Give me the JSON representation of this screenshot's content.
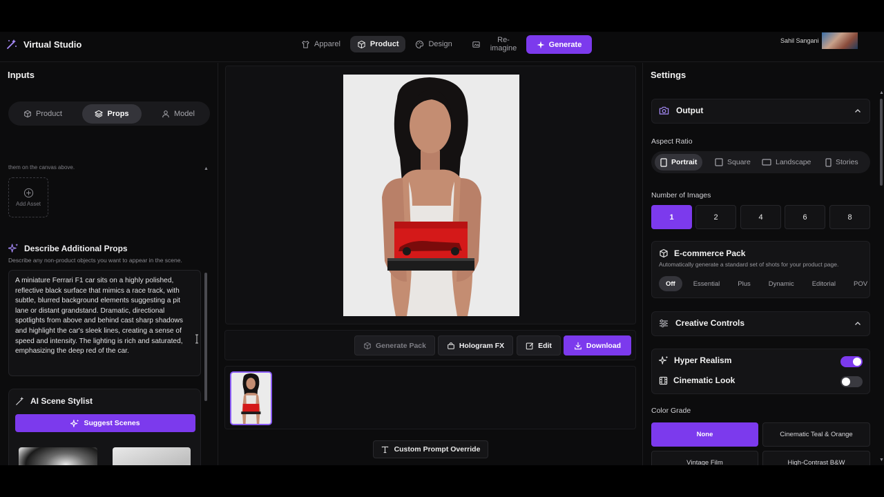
{
  "header": {
    "brand": "Virtual Studio",
    "tabs": [
      {
        "label": "Apparel",
        "icon": "shirt-icon"
      },
      {
        "label": "Product",
        "icon": "box-icon",
        "active": true
      },
      {
        "label": "Design",
        "icon": "palette-icon"
      },
      {
        "label": "Re-\nimagine",
        "icon": "reimagine-icon"
      }
    ],
    "generate_label": "Generate",
    "user_name": "Sahil Sangani"
  },
  "inputs": {
    "title": "Inputs",
    "tabs": [
      {
        "label": "Product"
      },
      {
        "label": "Props",
        "active": true
      },
      {
        "label": "Model"
      }
    ],
    "canvas_hint": "them on the canvas above.",
    "add_asset_label": "Add Asset",
    "props_title": "Describe Additional Props",
    "props_subtitle": "Describe any non-product objects you want to appear in the scene.",
    "props_text": "A miniature Ferrari F1 car sits on a highly polished, reflective black surface that mimics a race track, with subtle, blurred background elements suggesting a pit lane or distant grandstand. Dramatic, directional spotlights from above and behind cast sharp shadows and highlight the car's sleek lines, creating a sense of speed and intensity. The lighting is rich and saturated, emphasizing the deep red of the car.",
    "stylist_title": "AI Scene Stylist",
    "suggest_label": "Suggest Scenes"
  },
  "center": {
    "toolbar": {
      "generate_pack": "Generate Pack",
      "hologram": "Hologram FX",
      "edit": "Edit",
      "download": "Download"
    },
    "override_label": "Custom Prompt Override"
  },
  "settings": {
    "title": "Settings",
    "output_title": "Output",
    "aspect_label": "Aspect Ratio",
    "aspect_options": [
      {
        "label": "Portrait",
        "active": true
      },
      {
        "label": "Square"
      },
      {
        "label": "Landscape"
      },
      {
        "label": "Stories"
      }
    ],
    "num_images_label": "Number of Images",
    "num_images": [
      "1",
      "2",
      "4",
      "6",
      "8"
    ],
    "num_images_selected": "1",
    "pack_title": "E-commerce Pack",
    "pack_subtitle": "Automatically generate a standard set of shots for your product page.",
    "pack_options": [
      "Off",
      "Essential",
      "Plus",
      "Dynamic",
      "Editorial",
      "POV"
    ],
    "pack_selected": "Off",
    "creative_title": "Creative Controls",
    "hyper_realism": {
      "label": "Hyper Realism",
      "on": true
    },
    "cinematic_look": {
      "label": "Cinematic Look",
      "on": false
    },
    "color_grade_label": "Color Grade",
    "color_grades": [
      "None",
      "Cinematic Teal & Orange",
      "Vintage Film",
      "High-Contrast B&W"
    ],
    "color_grade_selected": "None"
  },
  "colors": {
    "accent": "#7c3aed",
    "background": "#0c0c0d",
    "panel": "#141416"
  }
}
